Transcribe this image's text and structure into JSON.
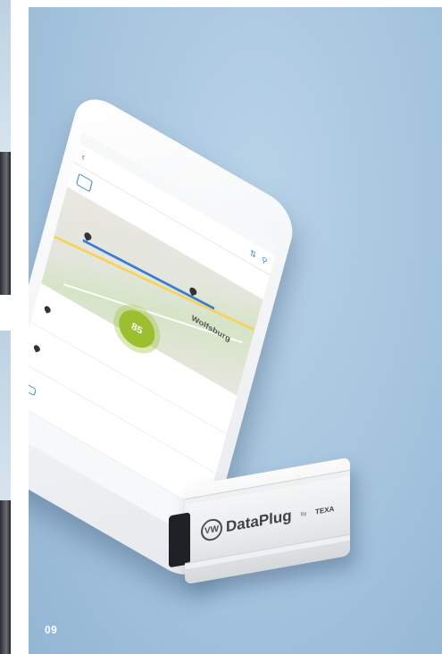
{
  "page": {
    "number": "09"
  },
  "phone": {
    "status": {
      "carrier": "",
      "time": "",
      "battery": ""
    },
    "nav": {
      "back_glyph": "‹",
      "title": "",
      "subtitle": ""
    },
    "trip": {
      "title": "",
      "subtitle": ""
    },
    "map": {
      "city_label": "Wolfsburg"
    },
    "score": {
      "value": "85",
      "unit": ""
    },
    "stops": [
      {
        "line1": "",
        "line2": "",
        "line3": ""
      },
      {
        "line1": "",
        "line2": "",
        "line3": ""
      },
      {
        "line1": "",
        "line2": ""
      }
    ]
  },
  "dongle": {
    "logo": "VW",
    "brand": "DataPlug",
    "by": "by",
    "maker": "TEXA"
  },
  "colors": {
    "panel": "#a6c4de",
    "score": "#9bbf2f",
    "accent": "#3c8ed6"
  }
}
